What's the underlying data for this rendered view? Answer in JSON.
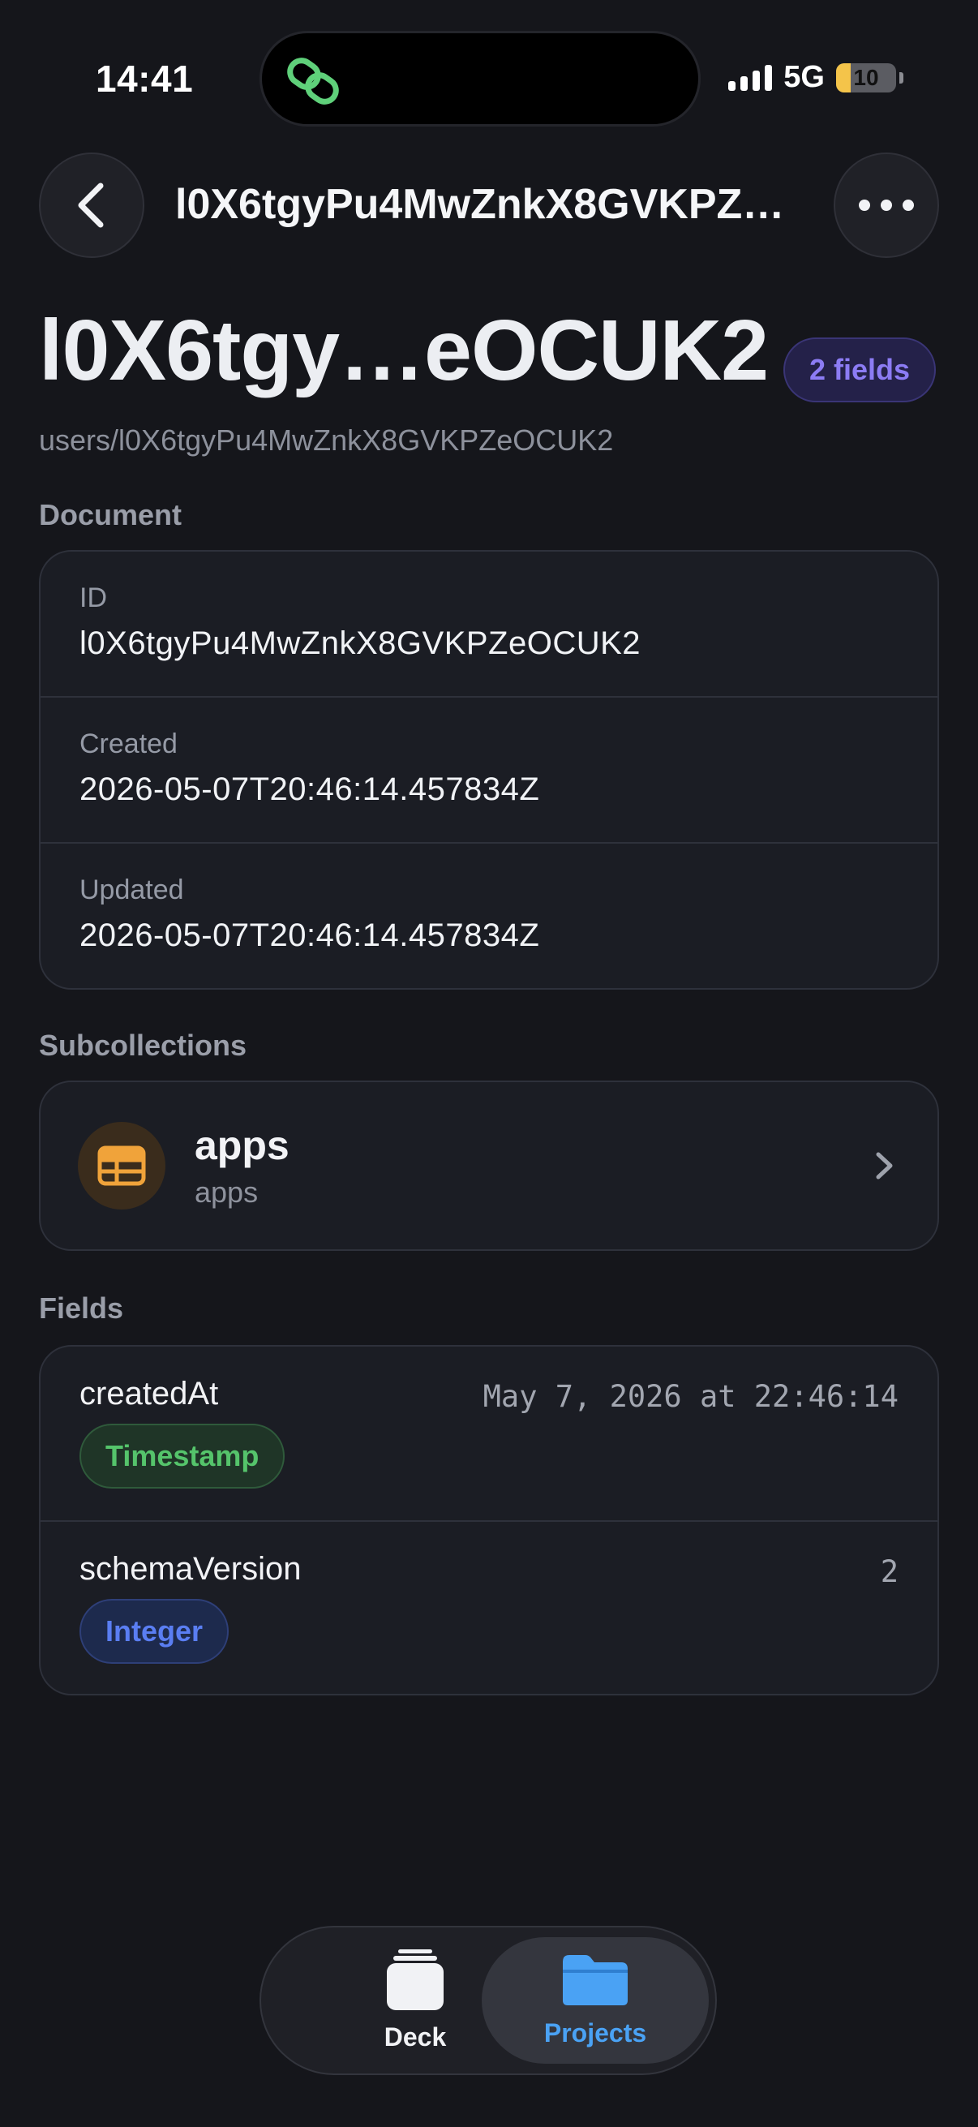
{
  "status_bar": {
    "time": "14:41",
    "network": "5G",
    "battery": "10",
    "island_icon": "link-icon"
  },
  "header": {
    "nav_title": "l0X6tgyPu4MwZnkX8GVKPZeOCUK2",
    "back_icon": "chevron-left-icon",
    "more_icon": "ellipsis-icon"
  },
  "document": {
    "title": "l0X6tgy…eOCUK2",
    "field_count_badge": "2 fields",
    "path": "users/l0X6tgyPu4MwZnkX8GVKPZeOCUK2"
  },
  "sections": {
    "document": "Document",
    "subcollections": "Subcollections",
    "fields": "Fields"
  },
  "document_info": [
    {
      "key": "ID",
      "value": "l0X6tgyPu4MwZnkX8GVKPZeOCUK2"
    },
    {
      "key": "Created",
      "value": "2026-05-07T20:46:14.457834Z"
    },
    {
      "key": "Updated",
      "value": "2026-05-07T20:46:14.457834Z"
    }
  ],
  "subcollections": [
    {
      "title": "apps",
      "subtitle": "apps",
      "icon": "table-icon"
    }
  ],
  "fields": [
    {
      "name": "createdAt",
      "value": "May 7, 2026 at 22:46:14",
      "type": "Timestamp",
      "type_color": "#55c46b"
    },
    {
      "name": "schemaVersion",
      "value": "2",
      "type": "Integer",
      "type_color": "#5a7ef2"
    }
  ],
  "tab_bar": {
    "tabs": [
      {
        "label": "Deck",
        "icon": "stack-icon",
        "selected": false
      },
      {
        "label": "Projects",
        "icon": "folder-icon",
        "selected": true
      }
    ]
  },
  "colors": {
    "background": "#15161b",
    "accent_blue": "#4aa2f4",
    "accent_purple": "#8c7cf4",
    "subcollection_icon": "#f0a33a"
  }
}
